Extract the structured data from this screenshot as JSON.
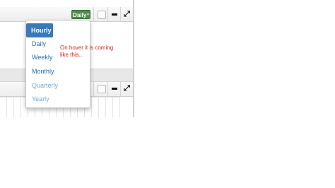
{
  "widget_top": {
    "interval_button_label": "Daily",
    "caret": "▾"
  },
  "header_icons": {
    "checkbox": "checkbox-icon",
    "minimize": "minus-icon",
    "expand": "expand-icon",
    "expand_glyph": "⤢"
  },
  "dropdown": {
    "items": [
      {
        "label": "Hourly",
        "state": "active"
      },
      {
        "label": "Daily",
        "state": "normal"
      },
      {
        "label": "Weekly",
        "state": "normal"
      },
      {
        "label": "Monthly",
        "state": "normal"
      },
      {
        "label": "Quarterly",
        "state": "muted"
      },
      {
        "label": "Yearly",
        "state": "muted"
      }
    ]
  },
  "annotation": {
    "text": "On hover it is coming like this.."
  },
  "colors": {
    "active_item": "#3a79b9",
    "link_blue": "#2a6db0",
    "annotation_red": "#e0261c",
    "interval_green": "#4f8a4c"
  }
}
